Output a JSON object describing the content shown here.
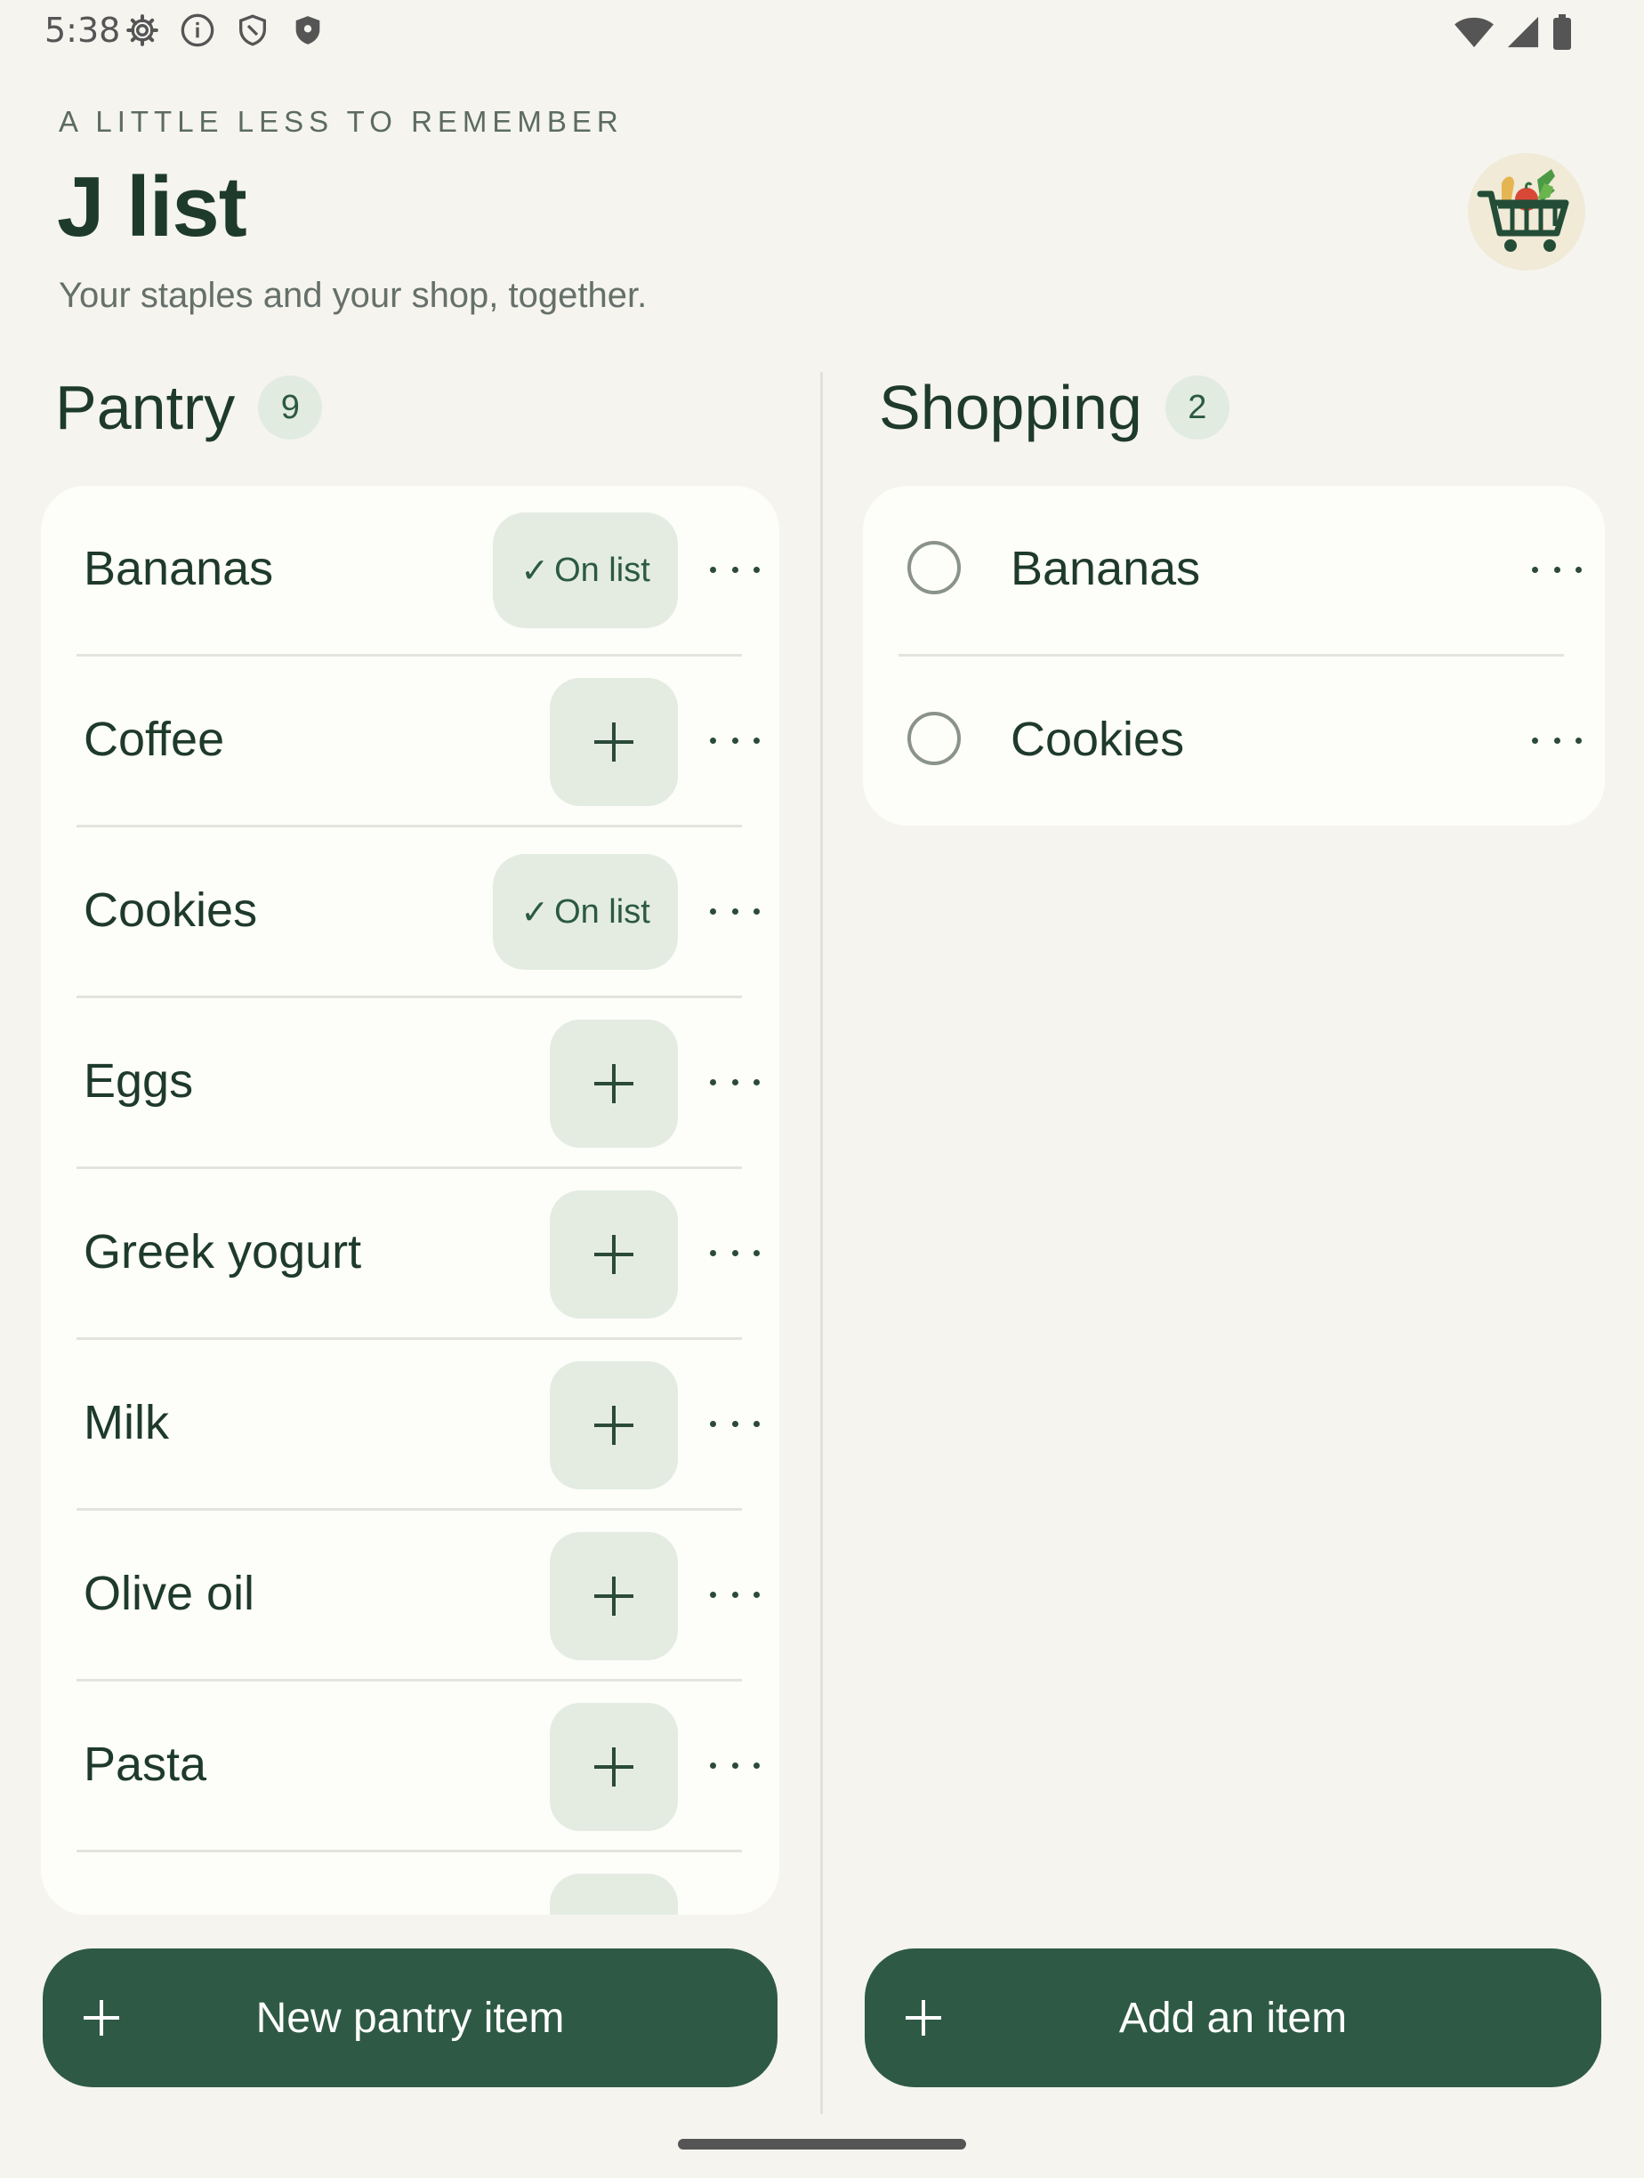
{
  "status_bar": {
    "time": "5:38",
    "left_icons": [
      "gear-icon",
      "info-icon",
      "shield-outline-icon",
      "shield-filled-icon"
    ],
    "right_icons": [
      "wifi-icon",
      "signal-icon",
      "battery-icon"
    ]
  },
  "header": {
    "eyebrow": "A LITTLE LESS TO REMEMBER",
    "title": "J list",
    "subtitle": "Your staples and your shop, together.",
    "avatar_icon": "grocery-cart-icon"
  },
  "pantry": {
    "title": "Pantry",
    "count": "9",
    "items": [
      {
        "label": "Bananas",
        "on_list": true
      },
      {
        "label": "Coffee",
        "on_list": false
      },
      {
        "label": "Cookies",
        "on_list": true
      },
      {
        "label": "Eggs",
        "on_list": false
      },
      {
        "label": "Greek yogurt",
        "on_list": false
      },
      {
        "label": "Milk",
        "on_list": false
      },
      {
        "label": "Olive oil",
        "on_list": false
      },
      {
        "label": "Pasta",
        "on_list": false
      },
      {
        "label": "",
        "on_list": false
      }
    ],
    "on_list_label": "On list",
    "new_button_label": "New pantry item"
  },
  "shopping": {
    "title": "Shopping",
    "count": "2",
    "items": [
      {
        "label": "Bananas",
        "checked": false
      },
      {
        "label": "Cookies",
        "checked": false
      }
    ],
    "add_button_label": "Add an item"
  },
  "colors": {
    "background": "#f5f4ef",
    "card": "#fdfdfa",
    "accent": "#2e5a45",
    "chip": "#e4ece1",
    "text": "#1e3a2b"
  }
}
